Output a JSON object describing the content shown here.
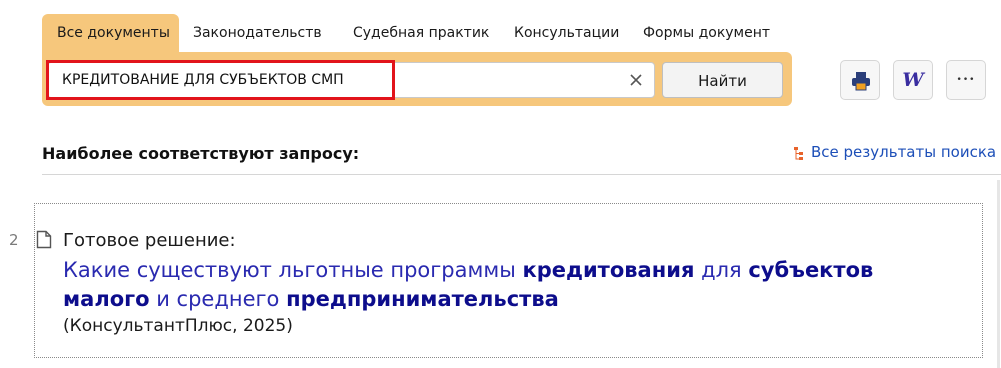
{
  "tabs": [
    {
      "label": "Все документы",
      "active": true
    },
    {
      "label": "Законодательств",
      "active": false
    },
    {
      "label": "Судебная практик",
      "active": false
    },
    {
      "label": "Консультации",
      "active": false
    },
    {
      "label": "Формы документ",
      "active": false
    }
  ],
  "search": {
    "value": "КРЕДИТОВАНИЕ ДЛЯ СУБЪЕКТОВ СМП",
    "find_label": "Найти"
  },
  "toolbar": {
    "print_icon": "printer-icon",
    "word_icon": "word-export-icon",
    "more_icon": "more-dots-icon",
    "word_glyph": "W",
    "more_glyph": "•••"
  },
  "section": {
    "title": "Наиболее соответствуют запросу:",
    "all_results_label": "Все результаты поиска"
  },
  "results": [
    {
      "number": "2",
      "type": "Готовое решение:",
      "title_parts": [
        {
          "text": "Какие существуют льготные программы ",
          "bold": false
        },
        {
          "text": "кредитования",
          "bold": true
        },
        {
          "text": " для ",
          "bold": false
        },
        {
          "text": "субъектов",
          "bold": true
        },
        {
          "text": " ",
          "bold": false
        },
        {
          "text": "малого",
          "bold": true
        },
        {
          "text": " и среднего ",
          "bold": false
        },
        {
          "text": "предпринимательства",
          "bold": true
        }
      ],
      "source": "(КонсультантПлюс, 2025)"
    }
  ],
  "colors": {
    "accent": "#f6c77c",
    "link": "#1d4fb8",
    "title": "#2a2ab0",
    "highlight": "#e2141b"
  }
}
